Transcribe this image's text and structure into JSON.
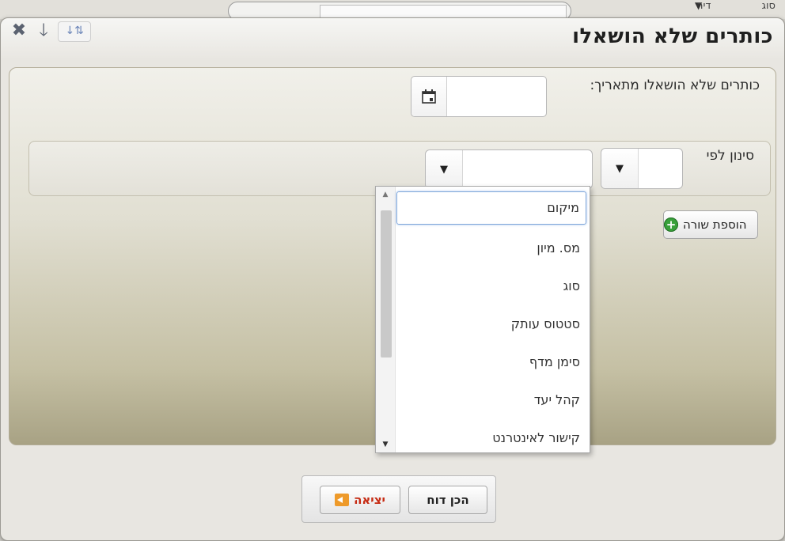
{
  "background": {
    "top_text": "סוג",
    "top_right_text": "דיר"
  },
  "dialog": {
    "title": "כותרים שלא הושאלו",
    "toolbar_icons": [
      "close-icon",
      "arrow-down-icon",
      "sort-az-icon"
    ]
  },
  "form": {
    "date_label": "כותרים שלא הושאלו מתאריך:",
    "date_value": "",
    "filter_label": "סינון לפי",
    "filter_field_value": "",
    "filter_value": "",
    "add_row_label": "הוספת שורה"
  },
  "dropdown": {
    "selected": "מיקום",
    "items": [
      "מיקום",
      "מס. מיון",
      "סוג",
      "סטטוס עותק",
      "סימן מדף",
      "קהל יעד",
      "קישור לאינטרנט"
    ]
  },
  "footer": {
    "report_label": "הכן דוח",
    "exit_label": "יציאה"
  },
  "colors": {
    "panel_top": "#f1f0ea",
    "panel_bottom": "#a8a284",
    "exit_text": "#c62b13",
    "plus_green": "#38a03a"
  }
}
